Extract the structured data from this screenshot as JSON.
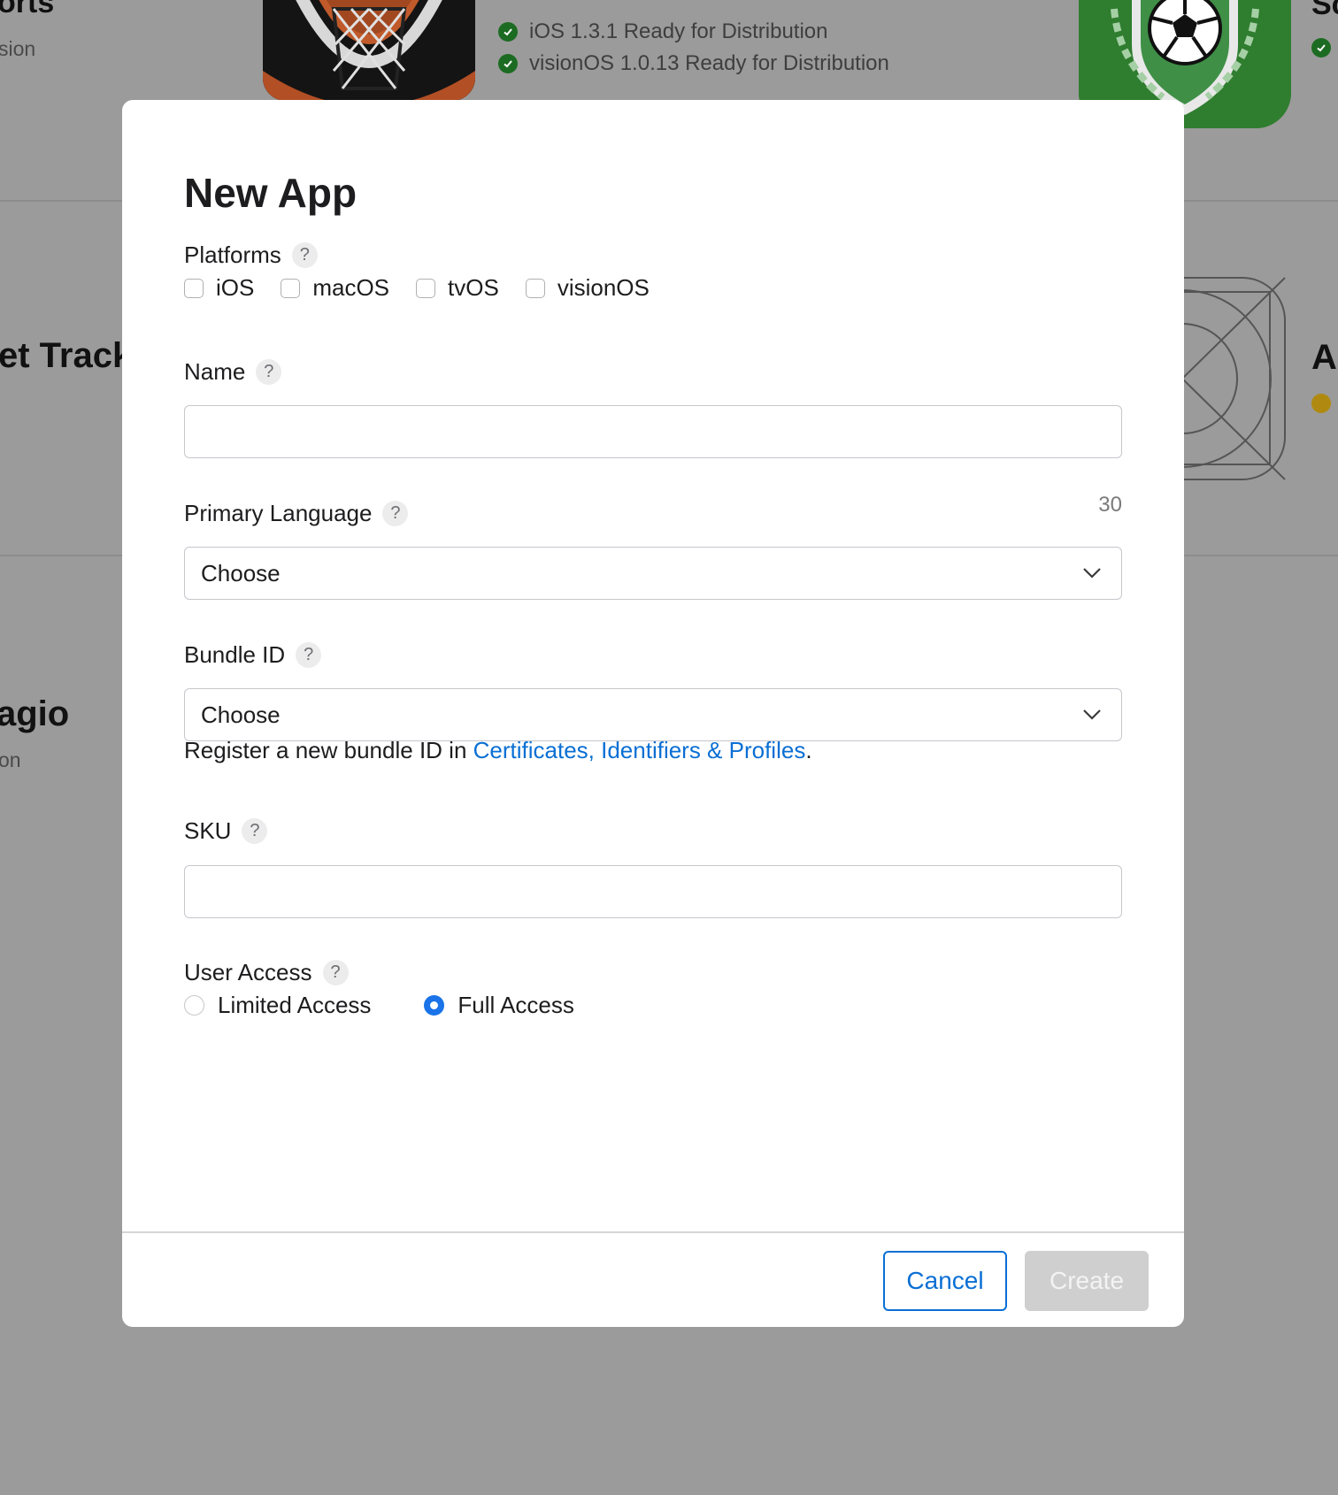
{
  "background": {
    "cards": [
      {
        "title_fragment": "orts",
        "subtitle_fragment": "sion"
      },
      {
        "title_fragment": "et Track"
      },
      {
        "title_fragment": "agio",
        "subtitle_fragment": "on"
      },
      {
        "title_fragment": "Sc"
      },
      {
        "title_fragment": "A"
      }
    ],
    "status_lines": [
      {
        "text": "iOS 1.3.1 Ready for Distribution",
        "status": "ready"
      },
      {
        "text": "visionOS 1.0.13 Ready for Distribution",
        "status": "ready"
      }
    ],
    "colors": {
      "ready": "#1c6b22",
      "pending": "#b08a10",
      "overlay": "#9b9b9b"
    }
  },
  "modal": {
    "title": "New App",
    "platforms": {
      "label": "Platforms",
      "options": [
        {
          "label": "iOS",
          "checked": false
        },
        {
          "label": "macOS",
          "checked": false
        },
        {
          "label": "tvOS",
          "checked": false
        },
        {
          "label": "visionOS",
          "checked": false
        }
      ]
    },
    "name": {
      "label": "Name",
      "value": "",
      "char_limit": "30"
    },
    "primary_language": {
      "label": "Primary Language",
      "selected": "Choose"
    },
    "bundle_id": {
      "label": "Bundle ID",
      "selected": "Choose",
      "help_prefix": "Register a new bundle ID in ",
      "help_link": "Certificates, Identifiers & Profiles",
      "help_suffix": "."
    },
    "sku": {
      "label": "SKU",
      "value": ""
    },
    "user_access": {
      "label": "User Access",
      "options": [
        {
          "label": "Limited Access",
          "selected": false
        },
        {
          "label": "Full Access",
          "selected": true
        }
      ]
    },
    "help_glyph": "?",
    "buttons": {
      "cancel": "Cancel",
      "create": "Create"
    },
    "colors": {
      "accent": "#0a6fd4",
      "radio": "#1a73e8",
      "disabled": "#cfcfcf"
    }
  }
}
